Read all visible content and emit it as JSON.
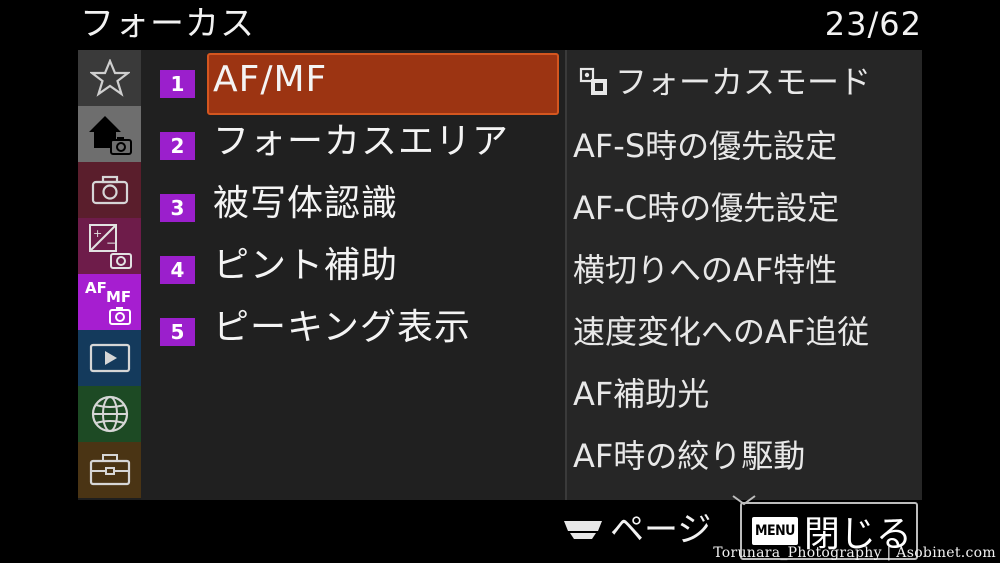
{
  "header": {
    "title": "フォーカス",
    "page_counter": "23/62"
  },
  "colors": {
    "accent_purple": "#9b1fcc",
    "selected_bg": "#9c3412",
    "selected_border": "#d4561f"
  },
  "sidebar": {
    "tabs": [
      {
        "icon": "star-icon",
        "label": ""
      },
      {
        "icon": "home-camera-icon",
        "label": ""
      },
      {
        "icon": "camera-icon",
        "label": ""
      },
      {
        "icon": "exposure-camera-icon",
        "label": ""
      },
      {
        "icon": "af-mf-camera-icon",
        "label": "AF MF"
      },
      {
        "icon": "playback-icon",
        "label": ""
      },
      {
        "icon": "globe-icon",
        "label": ""
      },
      {
        "icon": "toolbox-icon",
        "label": ""
      }
    ]
  },
  "main": {
    "items": [
      {
        "number": "1",
        "label": "AF/MF",
        "selected": true
      },
      {
        "number": "2",
        "label": "フォーカスエリア",
        "selected": false
      },
      {
        "number": "3",
        "label": "被写体認識",
        "selected": false
      },
      {
        "number": "4",
        "label": "ピント補助",
        "selected": false
      },
      {
        "number": "5",
        "label": "ピーキング表示",
        "selected": false
      }
    ]
  },
  "submenu": {
    "items": [
      "フォーカスモード",
      "AF-S時の優先設定",
      "AF-C時の優先設定",
      "横切りへのAF特性",
      "速度変化へのAF追従",
      "AF補助光",
      "AF時の絞り駆動"
    ]
  },
  "footer": {
    "page_label": "ページ",
    "menu_badge": "MENU",
    "close_label": "閉じる"
  },
  "watermark": "Torunara_Photography | Asobinet.com"
}
